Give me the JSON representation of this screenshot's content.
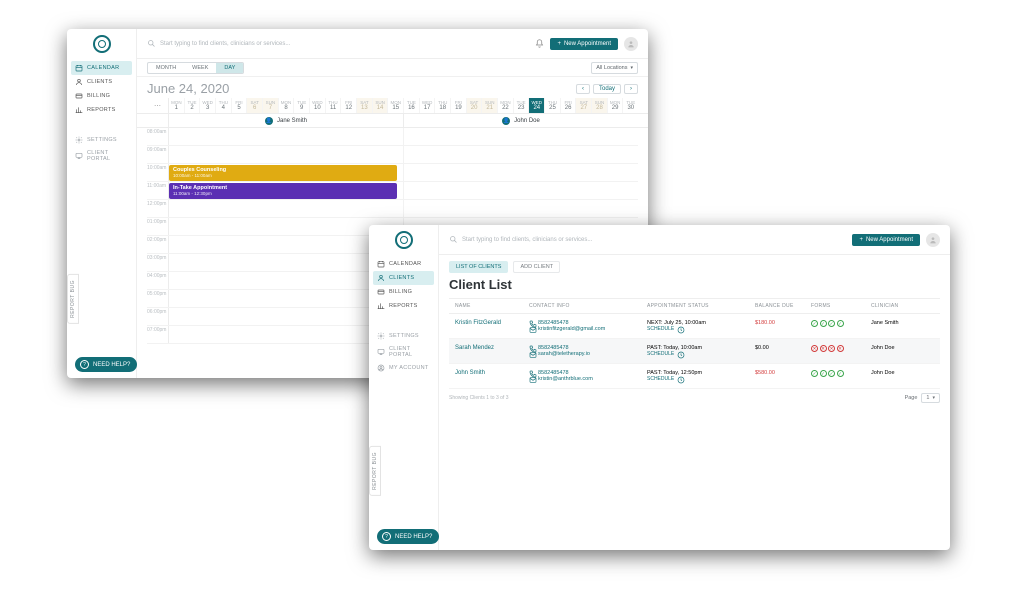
{
  "common": {
    "search_placeholder": "Start typing to find clients, clinicians or services...",
    "new_appointment": "New Appointment",
    "need_help": "NEED HELP?",
    "report_bug": "REPORT BUG"
  },
  "sidebar": {
    "items": [
      {
        "label": "CALENDAR",
        "icon": "calendar"
      },
      {
        "label": "CLIENTS",
        "icon": "user"
      },
      {
        "label": "BILLING",
        "icon": "card"
      },
      {
        "label": "REPORTS",
        "icon": "chart"
      }
    ],
    "sys": [
      {
        "label": "SETTINGS",
        "icon": "gear"
      },
      {
        "label": "CLIENT PORTAL",
        "icon": "monitor"
      },
      {
        "label": "MY ACCOUNT",
        "icon": "account"
      }
    ],
    "active_a": 0,
    "active_b": 1
  },
  "winA": {
    "view_seg": [
      "MONTH",
      "WEEK",
      "DAY"
    ],
    "view_active": "DAY",
    "location_select": "All Locations",
    "date_title": "June 24, 2020",
    "today": "Today",
    "month_strip": [
      {
        "dow": "MON",
        "num": "1"
      },
      {
        "dow": "TUE",
        "num": "2"
      },
      {
        "dow": "WED",
        "num": "3"
      },
      {
        "dow": "THU",
        "num": "4"
      },
      {
        "dow": "FRI",
        "num": "5"
      },
      {
        "dow": "SAT",
        "num": "6",
        "we": true
      },
      {
        "dow": "SUN",
        "num": "7",
        "we": true
      },
      {
        "dow": "MON",
        "num": "8"
      },
      {
        "dow": "TUE",
        "num": "9"
      },
      {
        "dow": "WED",
        "num": "10"
      },
      {
        "dow": "THU",
        "num": "11"
      },
      {
        "dow": "FRI",
        "num": "12"
      },
      {
        "dow": "SAT",
        "num": "13",
        "we": true
      },
      {
        "dow": "SUN",
        "num": "14",
        "we": true
      },
      {
        "dow": "MON",
        "num": "15"
      },
      {
        "dow": "TUE",
        "num": "16"
      },
      {
        "dow": "WED",
        "num": "17"
      },
      {
        "dow": "THU",
        "num": "18"
      },
      {
        "dow": "FRI",
        "num": "19"
      },
      {
        "dow": "SAT",
        "num": "20",
        "we": true
      },
      {
        "dow": "SUN",
        "num": "21",
        "we": true
      },
      {
        "dow": "MON",
        "num": "22"
      },
      {
        "dow": "TUE",
        "num": "23"
      },
      {
        "dow": "WED",
        "num": "24",
        "sel": true
      },
      {
        "dow": "THU",
        "num": "25"
      },
      {
        "dow": "FRI",
        "num": "26"
      },
      {
        "dow": "SAT",
        "num": "27",
        "we": true
      },
      {
        "dow": "SUN",
        "num": "28",
        "we": true
      },
      {
        "dow": "MON",
        "num": "29"
      },
      {
        "dow": "TUE",
        "num": "30"
      }
    ],
    "clinicians": [
      "Jane Smith",
      "John Doe"
    ],
    "hours": [
      "08:00am",
      "09:00am",
      "10:00am",
      "11:00am",
      "12:00pm",
      "01:00pm",
      "02:00pm",
      "03:00pm",
      "04:00pm",
      "05:00pm",
      "06:00pm",
      "07:00pm"
    ],
    "events": [
      {
        "title": "Couples Counseling",
        "sub": "10:00am - 11:00am"
      },
      {
        "title": "In-Take Appointment",
        "sub": "11:00am - 12:30pm"
      }
    ]
  },
  "winB": {
    "tabs": [
      "LIST OF CLIENTS",
      "ADD CLIENT"
    ],
    "page_title": "Client List",
    "columns": [
      "NAME",
      "CONTACT INFO",
      "APPOINTMENT STATUS",
      "BALANCE DUE",
      "FORMS",
      "CLINICIAN"
    ],
    "schedule_label": "SCHEDULE",
    "rows": [
      {
        "name": "Kristin FitzGerald",
        "phone": "8582485478",
        "email": "kristinfitzgerald@gmail.com",
        "appt": "NEXT: July 25, 10:00am",
        "balance": "$180.00",
        "balance_red": true,
        "forms": "gggg",
        "clinician": "Jane Smith"
      },
      {
        "name": "Sarah Mendez",
        "phone": "8582485478",
        "email": "sarah@teletherapy.io",
        "appt": "PAST: Today, 10:00am",
        "balance": "$0.00",
        "balance_red": false,
        "forms": "rrrr",
        "clinician": "John Doe"
      },
      {
        "name": "John Smith",
        "phone": "8582485478",
        "email": "kristin@anthrblue.com",
        "appt": "PAST: Today, 12:50pm",
        "balance": "$580.00",
        "balance_red": true,
        "forms": "gggg",
        "clinician": "John Doe"
      }
    ],
    "pager_info": "Showing Clients 1 to 3 of 3",
    "pager_label": "Page",
    "pager_value": "1"
  }
}
